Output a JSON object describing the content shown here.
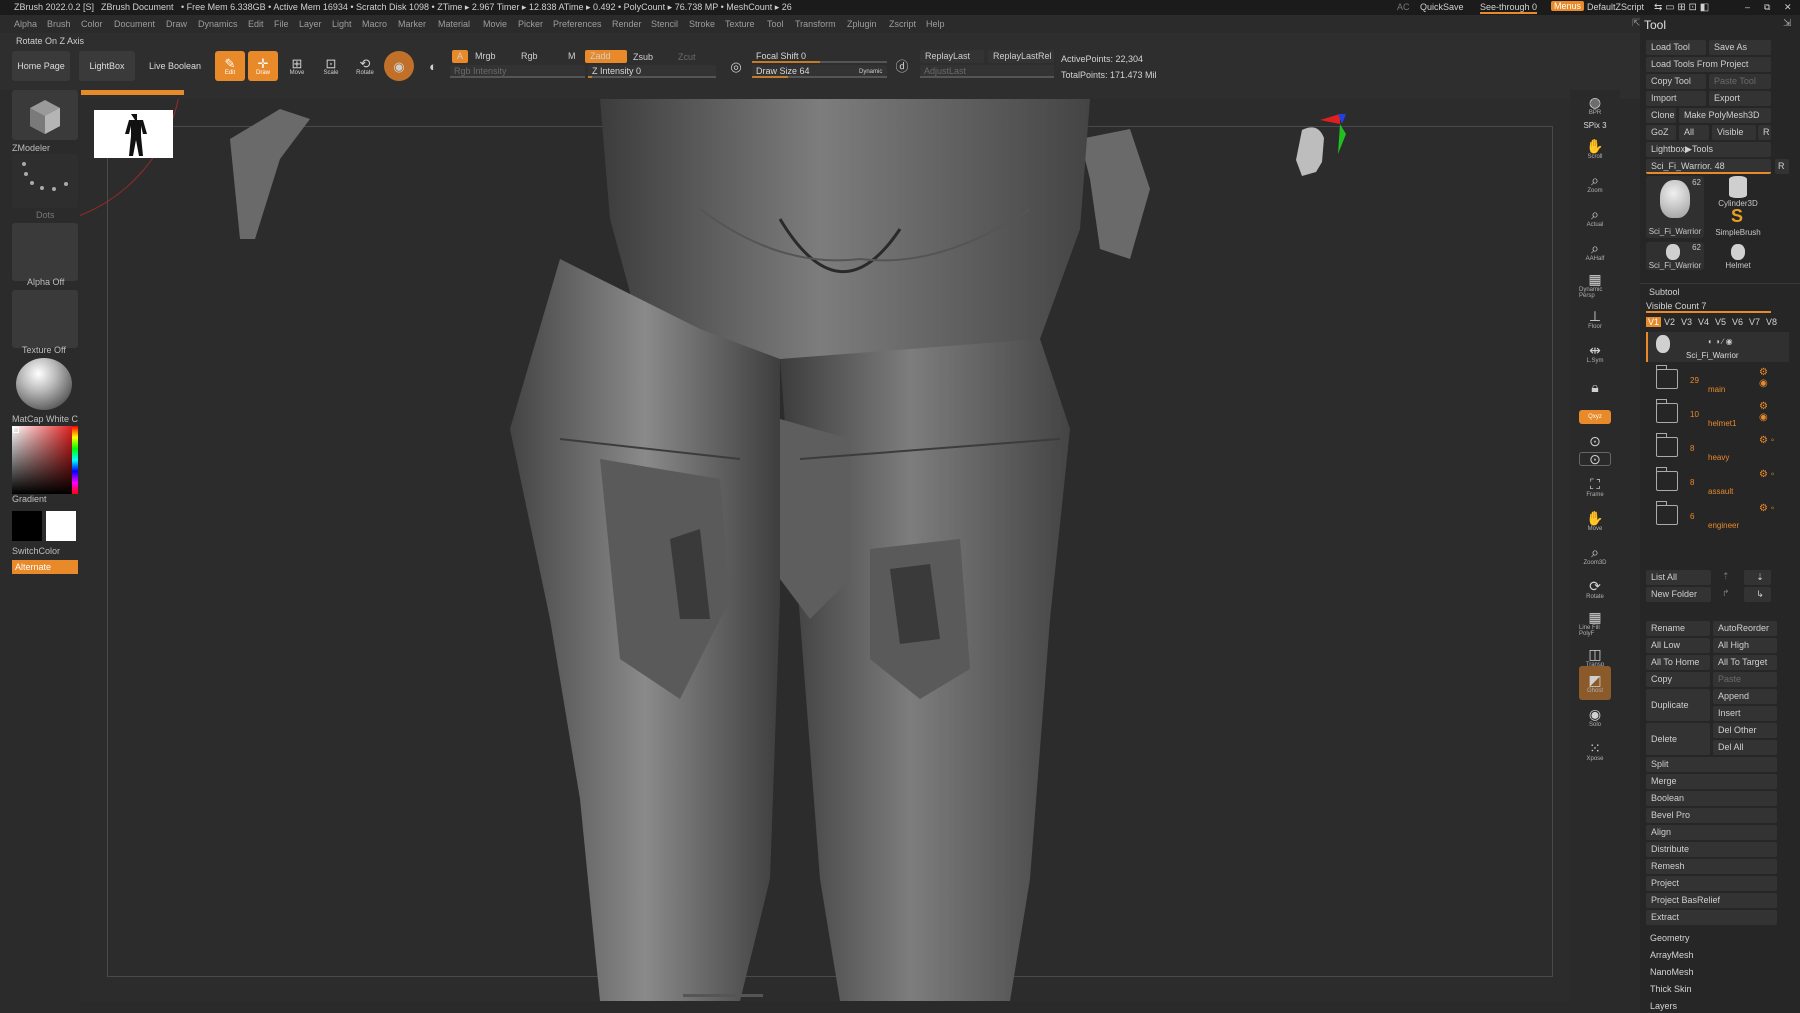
{
  "titlebar": {
    "app": "ZBrush 2022.0.2 [S]",
    "document": "ZBrush Document",
    "stats": "• Free Mem 6.338GB • Active Mem 16934 • Scratch Disk 1098 • ZTime ▸ 2.967 Timer ▸ 12.838 ATime ▸ 0.492 • PolyCount ▸ 76.738 MP • MeshCount ▸ 26",
    "ac": "AC",
    "quicksave": "QuickSave",
    "seethrough": "See-through  0",
    "menus": "Menus",
    "script": "DefaultZScript"
  },
  "menubar": [
    "Alpha",
    "Brush",
    "Color",
    "Document",
    "Draw",
    "Dynamics",
    "Edit",
    "File",
    "Layer",
    "Light",
    "Macro",
    "Marker",
    "Material",
    "Movie",
    "Picker",
    "Preferences",
    "Render",
    "Stencil",
    "Stroke",
    "Texture",
    "Tool",
    "Transform",
    "Zplugin",
    "Zscript",
    "Help"
  ],
  "rotate_label": "Rotate On Z Axis",
  "toolbar": {
    "home": "Home Page",
    "lightbox": "LightBox",
    "liveboolean": "Live Boolean",
    "edit": "Edit",
    "draw": "Draw",
    "move": "Move",
    "scale": "Scale",
    "rotate": "Rotate",
    "a": "A",
    "mrgb": "Mrgb",
    "rgb": "Rgb",
    "m": "M",
    "zadd": "Zadd",
    "zsub": "Zsub",
    "zcut": "Zcut",
    "rgb_intensity": "Rgb Intensity",
    "z_intensity": "Z Intensity 0",
    "focal_shift": "Focal Shift 0",
    "draw_size": "Draw Size 64",
    "dynamic": "Dynamic",
    "replay_last": "ReplayLast",
    "replay_last_rel": "ReplayLastRel",
    "adjust_last": "AdjustLast",
    "active_points": "ActivePoints: 22,304",
    "total_points": "TotalPoints: 171.473 Mil",
    "progress": 0.58
  },
  "left": {
    "zmodeler": "ZModeler",
    "dots": "Dots",
    "alpha": "Alpha Off",
    "texture": "Texture Off",
    "matcap": "MatCap White C",
    "gradient": "Gradient",
    "switchcolor": "SwitchColor",
    "alternate": "Alternate"
  },
  "rightstrip": [
    "BPR",
    "SPix 3",
    "Scroll",
    "Zoom",
    "Actual",
    "AAHalf",
    "Dynamic Persp",
    "Floor",
    "L.Sym",
    "Lock",
    "Qxyz",
    "Frame",
    "Move",
    "Zoom3D",
    "Rotate",
    "Line Fill PolyF",
    "Transp",
    "Ghost",
    "Solo",
    "Xpose"
  ],
  "tool": {
    "title": "Tool",
    "load_tool": "Load Tool",
    "save_as": "Save As",
    "load_from_project": "Load Tools From Project",
    "copy_tool": "Copy Tool",
    "paste_tool": "Paste Tool",
    "import": "Import",
    "export": "Export",
    "clone": "Clone",
    "make_polymesh": "Make PolyMesh3D",
    "goz": "GoZ",
    "all": "All",
    "visible": "Visible",
    "r": "R",
    "lightbox_tools": "Lightbox▶Tools",
    "current_tool": "Sci_Fi_Warrior. 48",
    "thumbs": [
      {
        "name": "Sci_Fi_Warrior",
        "count": "62"
      },
      {
        "name": "Cylinder3D",
        "count": ""
      },
      {
        "name": "SimpleBrush",
        "count": ""
      },
      {
        "name": "Sci_Fi_Warrior",
        "count": "62"
      },
      {
        "name": "Helmet",
        "count": ""
      }
    ],
    "subtool": "Subtool",
    "visible_count": "Visible Count 7",
    "versions": [
      "V1",
      "V2",
      "V3",
      "V4",
      "V5",
      "V6",
      "V7",
      "V8"
    ],
    "top_subtool": "Sci_Fi_Warrior",
    "folders": [
      {
        "count": "29",
        "name": "main"
      },
      {
        "count": "10",
        "name": "helmet1"
      },
      {
        "count": "8",
        "name": "heavy"
      },
      {
        "count": "8",
        "name": "assault"
      },
      {
        "count": "6",
        "name": "engineer"
      }
    ],
    "list_all": "List All",
    "new_folder": "New Folder",
    "rename": "Rename",
    "autoreorder": "AutoReorder",
    "all_low": "All Low",
    "all_high": "All High",
    "all_to_home": "All To Home",
    "all_to_target": "All To Target",
    "copy": "Copy",
    "paste": "Paste",
    "duplicate": "Duplicate",
    "append": "Append",
    "insert": "Insert",
    "delete": "Delete",
    "del_other": "Del Other",
    "del_all": "Del All",
    "actions": [
      "Split",
      "Merge",
      "Boolean",
      "Bevel Pro",
      "Align",
      "Distribute",
      "Remesh",
      "Project",
      "Project BasRelief",
      "Extract"
    ],
    "sections": [
      "Geometry",
      "ArrayMesh",
      "NanoMesh",
      "Thick Skin",
      "Layers"
    ]
  },
  "colors": {
    "accent": "#e8892a",
    "panel": "#262626",
    "viewport": "#2c2c2c"
  }
}
